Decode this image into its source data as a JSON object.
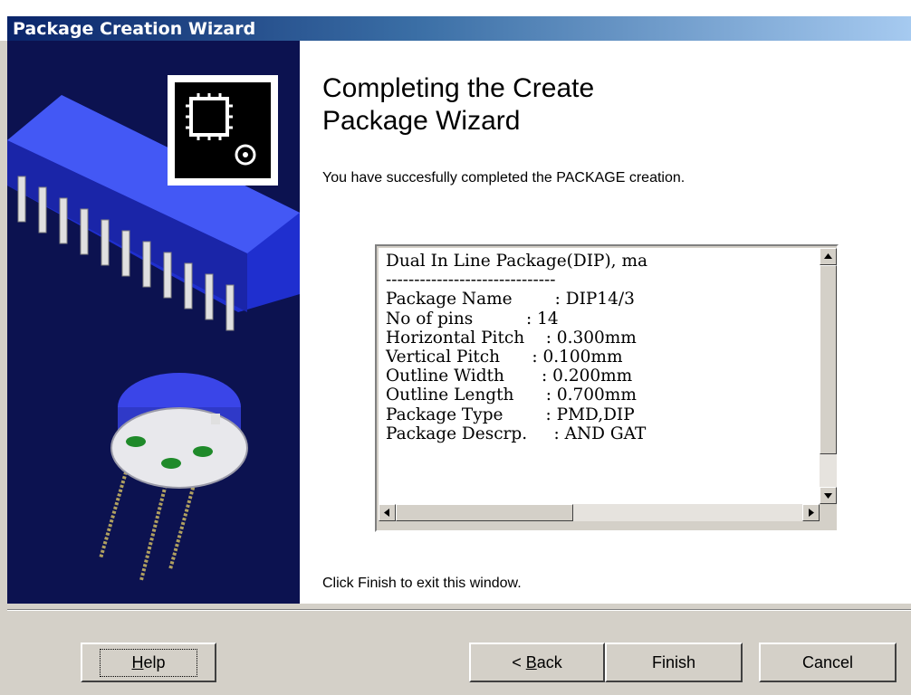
{
  "window": {
    "title": "Package Creation Wizard"
  },
  "page": {
    "heading_line1": "Completing the Create",
    "heading_line2": "Package Wizard",
    "description": "You have succesfully completed the PACKAGE creation.",
    "finish_message": "Click Finish to exit this window."
  },
  "summary": {
    "lines": [
      "Dual In Line Package(DIP), ma",
      "------------------------------",
      "Package Name        : DIP14/3",
      "No of pins          : 14",
      "Horizontal Pitch    : 0.300mm",
      "Vertical Pitch      : 0.100mm",
      "Outline Width       : 0.200mm",
      "Outline Length      : 0.700mm",
      "Package Type        : PMD,DIP",
      "Package Descrp.     : AND GAT"
    ]
  },
  "buttons": {
    "help": "Help",
    "help_mnemonic": "H",
    "back_prefix": "< ",
    "back_mnemonic": "B",
    "back_rest": "ack",
    "finish": "Finish",
    "cancel": "Cancel"
  },
  "icons": {
    "scroll_up": "up-arrow-icon",
    "scroll_down": "down-arrow-icon",
    "scroll_left": "left-arrow-icon",
    "scroll_right": "right-arrow-icon",
    "wizard_chip": "chip-package-icon"
  },
  "colors": {
    "title_bar_start": "#0a246a",
    "title_bar_end": "#a6caf0",
    "side_panel": "#0c1250",
    "face": "#d4d0c8"
  }
}
